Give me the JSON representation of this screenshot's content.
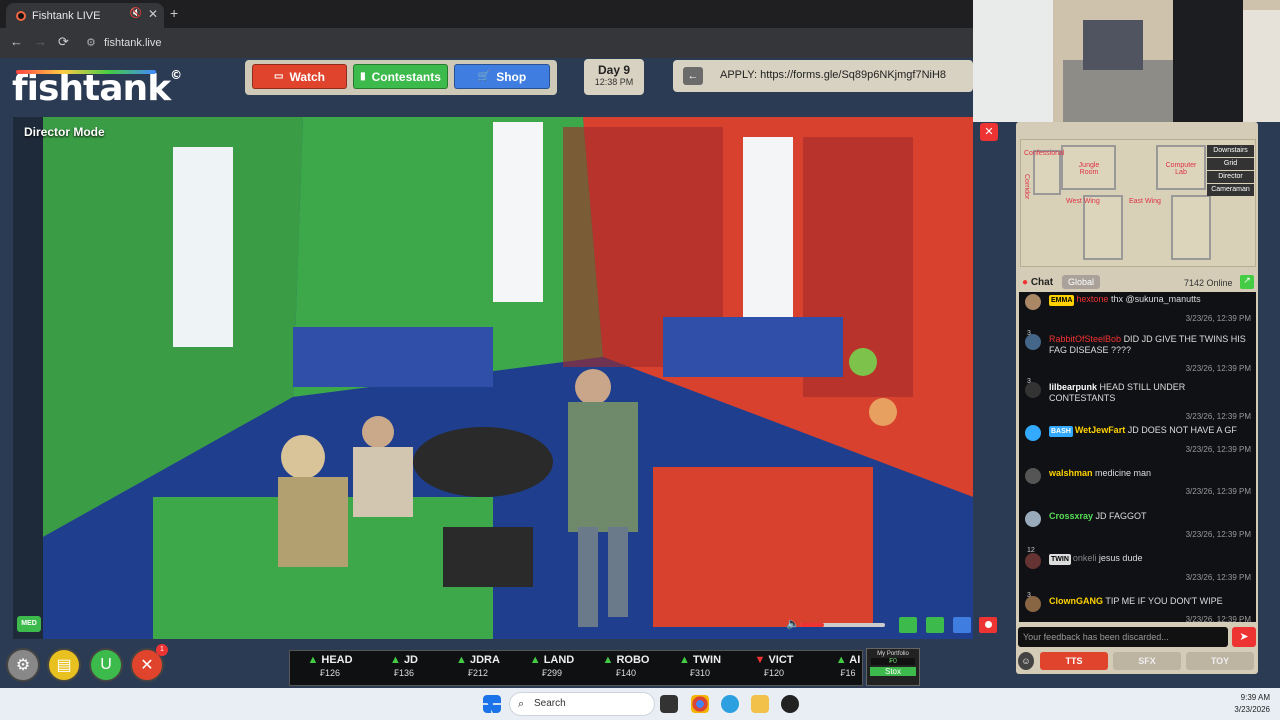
{
  "browser": {
    "tab_title": "Fishtank LIVE",
    "mute_glyph": "🔇",
    "close_glyph": "✕",
    "new_tab_glyph": "+",
    "url": "fishtank.live",
    "back_glyph": "←",
    "forward_glyph": "→",
    "reload_glyph": "⟳",
    "tune_glyph": "⚙"
  },
  "site": {
    "logo": "fishtank",
    "logo_mark": "©",
    "nav": {
      "watch": "Watch",
      "contestants": "Contestants",
      "shop": "Shop"
    },
    "day": "Day 9",
    "time": "12:38 PM",
    "apply_text": "APPLY: https://forms.gle/Sq89p6NKjmgf7NiH8",
    "apply_back_glyph": "←"
  },
  "video": {
    "mode_label": "Director Mode",
    "quality": "MED",
    "close_glyph": "✕"
  },
  "map": {
    "rooms": [
      "Confessional",
      "Jungle Room",
      "Computer Lab",
      "Corridor",
      "West Wing",
      "East Wing"
    ],
    "buttons": [
      "Downstairs",
      "Grid",
      "Director",
      "Cameraman"
    ]
  },
  "chat": {
    "title": "Chat",
    "tab_global": "Global",
    "online": "7142 Online",
    "messages": [
      {
        "badge": "EMMA",
        "user": "hextone",
        "text": "thx @sukuna_manutts",
        "time": "3/23/26, 12:39 PM",
        "user_color": "#e33",
        "badge_color": "#ffd200"
      },
      {
        "badge": "",
        "user": "RabbitOfSteelBob",
        "text": "DID JD GIVE THE TWINS HIS FAG DISEASE ????",
        "time": "3/23/26, 12:39 PM",
        "user_color": "#e33",
        "badge_color": ""
      },
      {
        "badge": "",
        "user": "lilbearpunk",
        "text": "HEAD STILL UNDER CONTESTANTS",
        "time": "3/23/26, 12:39 PM",
        "user_color": "#fff",
        "badge_color": ""
      },
      {
        "badge": "BASH",
        "user": "WetJewFart",
        "text": "JD DOES NOT HAVE A GF",
        "time": "3/23/26, 12:39 PM",
        "user_color": "#ffd200",
        "badge_color": "#3af"
      },
      {
        "badge": "",
        "user": "walshman",
        "text": "medicine man",
        "time": "3/23/26, 12:39 PM",
        "user_color": "#ffd200",
        "badge_color": ""
      },
      {
        "badge": "",
        "user": "Crossxray",
        "text": "JD FAGGOT",
        "time": "3/23/26, 12:39 PM",
        "user_color": "#5d5",
        "badge_color": ""
      },
      {
        "badge": "TWIN",
        "user": "onkeli",
        "text": "jesus dude",
        "time": "3/23/26, 12:39 PM",
        "user_color": "#888",
        "badge_color": "#ddd"
      },
      {
        "badge": "",
        "user": "ClownGANG",
        "text": "TIP ME IF YOU DON'T WIPE",
        "time": "3/23/26, 12:39 PM",
        "user_color": "#ffd200",
        "badge_color": ""
      }
    ],
    "msg_counts": [
      "3",
      "3",
      "12",
      "3"
    ],
    "feedback_placeholder": "Your feedback has been discarded...",
    "send_glyph": "➤",
    "tts": "TTS",
    "sfx": "SFX",
    "toy": "TOY"
  },
  "ticker": [
    {
      "name": "HEAD",
      "price": "₣126",
      "dir": "up"
    },
    {
      "name": "JD",
      "price": "₣136",
      "dir": "up"
    },
    {
      "name": "JDRA",
      "price": "₣212",
      "dir": "up"
    },
    {
      "name": "LAND",
      "price": "₣299",
      "dir": "up"
    },
    {
      "name": "ROBO",
      "price": "₣140",
      "dir": "up"
    },
    {
      "name": "TWIN",
      "price": "₣310",
      "dir": "up"
    },
    {
      "name": "VICT",
      "price": "₣120",
      "dir": "down"
    },
    {
      "name": "AI",
      "price": "₣16",
      "dir": "up"
    }
  ],
  "portfolio": {
    "label": "My Portfolio",
    "value": "₣0",
    "button": "Stox"
  },
  "bottom_badge": "1",
  "taskbar": {
    "search": "Search",
    "time": "9:39 AM",
    "date": "3/23/2026"
  }
}
